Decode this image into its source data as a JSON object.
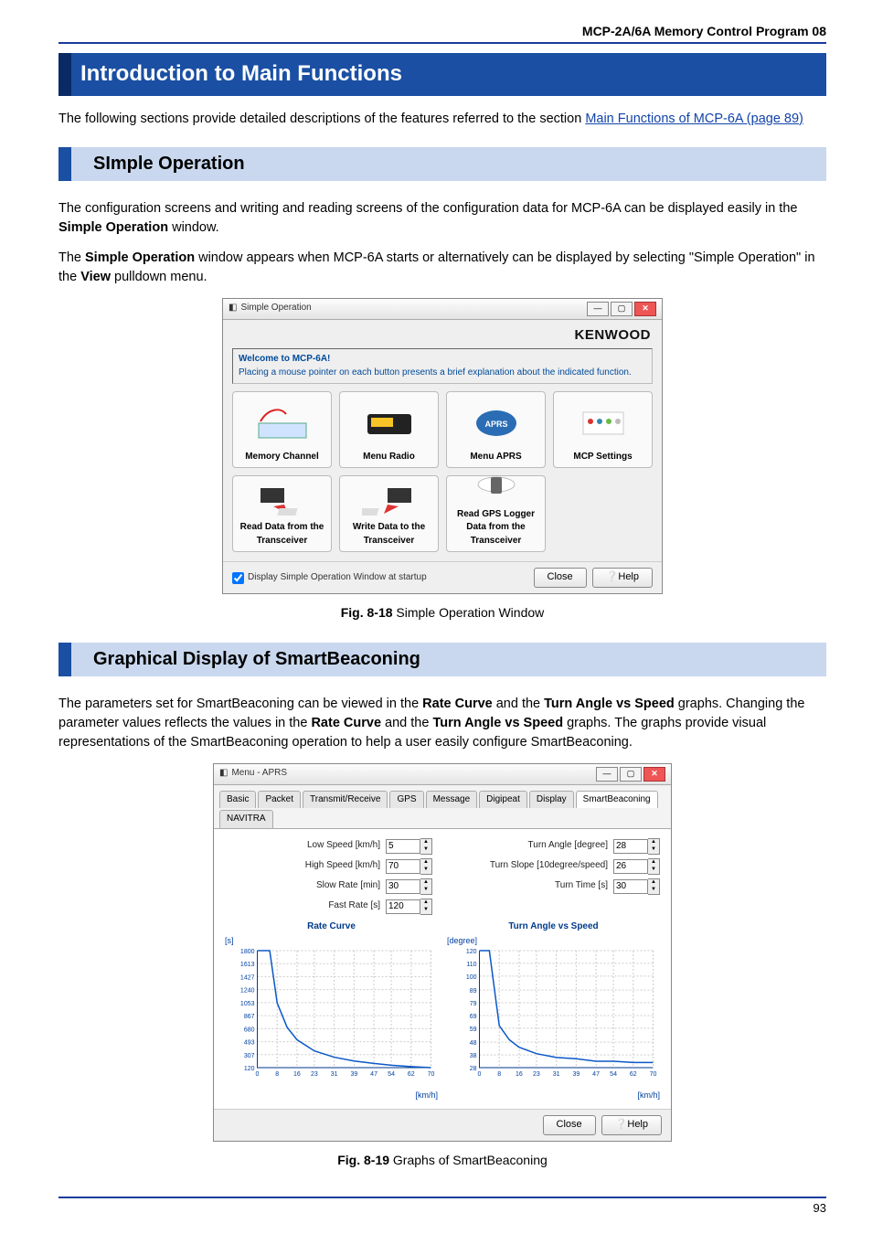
{
  "header": {
    "title": "MCP-2A/6A Memory Control Program  08"
  },
  "h1": "Introduction to Main Functions",
  "intro_prefix": "The following sections provide detailed descriptions of the features referred to the section ",
  "intro_link": "Main Functions of MCP-6A (page 89)",
  "section_simple": {
    "title": "SImple Operation",
    "p1_a": "The configuration screens and writing and reading screens of the configuration data for MCP-6A can be displayed easily in the ",
    "p1_b": "Simple Operation",
    "p1_c": " window.",
    "p2_a": "The ",
    "p2_b": "Simple Operation",
    "p2_c": " window appears when MCP-6A starts or alternatively can be displayed by selecting \"Simple Operation\" in the ",
    "p2_d": "View",
    "p2_e": " pulldown menu.",
    "win": {
      "title": "Simple Operation",
      "brand": "KENWOOD",
      "welcome_title": "Welcome to MCP-6A!",
      "welcome_msg": "Placing a mouse pointer on each button presents a brief explanation about the indicated function.",
      "tiles": {
        "r1": [
          "Memory Channel",
          "Menu Radio",
          "Menu APRS",
          "MCP Settings"
        ],
        "r2": [
          "Read Data from the Transceiver",
          "Write Data to the Transceiver",
          "Read GPS Logger Data from the Transceiver"
        ]
      },
      "startup_chk": "Display Simple Operation Window at startup",
      "close": "Close",
      "help": "Help"
    },
    "fig_label": "Fig. 8-18",
    "fig_caption": " Simple Operation Window"
  },
  "section_sb": {
    "title": "Graphical Display of SmartBeaconing",
    "p1_a": "The parameters set for SmartBeaconing can be viewed in the ",
    "p1_b": "Rate Curve",
    "p1_c": " and the ",
    "p1_d": "Turn Angle vs Speed",
    "p1_e": " graphs. Changing the parameter values reflects the values in the ",
    "p1_f": "Rate Curve",
    "p1_g": " and the ",
    "p1_h": "Turn Angle vs Speed",
    "p1_i": " graphs. The graphs provide visual representations of the SmartBeaconing operation to help a user easily configure SmartBeaconing.",
    "win": {
      "title": "Menu - APRS",
      "tabs": [
        "Basic",
        "Packet",
        "Transmit/Receive",
        "GPS",
        "Message",
        "Digipeat",
        "Display",
        "SmartBeaconing",
        "NAVITRA"
      ],
      "active_tab": 7,
      "params_left": [
        {
          "label": "Low Speed [km/h]",
          "value": "5"
        },
        {
          "label": "High Speed [km/h]",
          "value": "70"
        },
        {
          "label": "Slow Rate [min]",
          "value": "30"
        },
        {
          "label": "Fast Rate [s]",
          "value": "120"
        }
      ],
      "params_right": [
        {
          "label": "Turn Angle [degree]",
          "value": "28"
        },
        {
          "label": "Turn Slope [10degree/speed]",
          "value": "26"
        },
        {
          "label": "Turn Time [s]",
          "value": "30"
        }
      ],
      "chart_left_title": "Rate Curve",
      "chart_right_title": "Turn Angle vs Speed",
      "y_unit_left": "[s]",
      "y_unit_right": "[degree]",
      "x_unit": "[km/h]",
      "close": "Close",
      "help": "Help"
    },
    "fig_label": "Fig. 8-19",
    "fig_caption": " Graphs of SmartBeaconing"
  },
  "chart_data": [
    {
      "type": "line",
      "title": "Rate Curve",
      "xlabel": "[km/h]",
      "ylabel": "[s]",
      "x_ticks": [
        0,
        8,
        16,
        23,
        31,
        39,
        47,
        54,
        62,
        70
      ],
      "y_ticks": [
        120,
        307,
        493,
        680,
        867,
        1053,
        1240,
        1427,
        1613,
        1800
      ],
      "series": [
        {
          "name": "rate",
          "x": [
            0,
            5,
            8,
            12,
            16,
            23,
            31,
            39,
            47,
            54,
            62,
            70
          ],
          "y": [
            1800,
            1800,
            1050,
            700,
            520,
            360,
            270,
            215,
            180,
            155,
            135,
            120
          ]
        }
      ],
      "xlim": [
        0,
        70
      ],
      "ylim": [
        120,
        1800
      ]
    },
    {
      "type": "line",
      "title": "Turn Angle vs Speed",
      "xlabel": "[km/h]",
      "ylabel": "[degree]",
      "x_ticks": [
        0,
        8,
        16,
        23,
        31,
        39,
        47,
        54,
        62,
        70
      ],
      "y_ticks": [
        28,
        38,
        48,
        59,
        69,
        79,
        89,
        100,
        110,
        120
      ],
      "series": [
        {
          "name": "turn",
          "x": [
            0,
            4,
            8,
            12,
            16,
            23,
            31,
            39,
            47,
            54,
            62,
            70
          ],
          "y": [
            120,
            120,
            61,
            50,
            44,
            39,
            36,
            35,
            33,
            33,
            32,
            32
          ]
        }
      ],
      "xlim": [
        0,
        70
      ],
      "ylim": [
        28,
        120
      ]
    }
  ],
  "page_number": "93"
}
